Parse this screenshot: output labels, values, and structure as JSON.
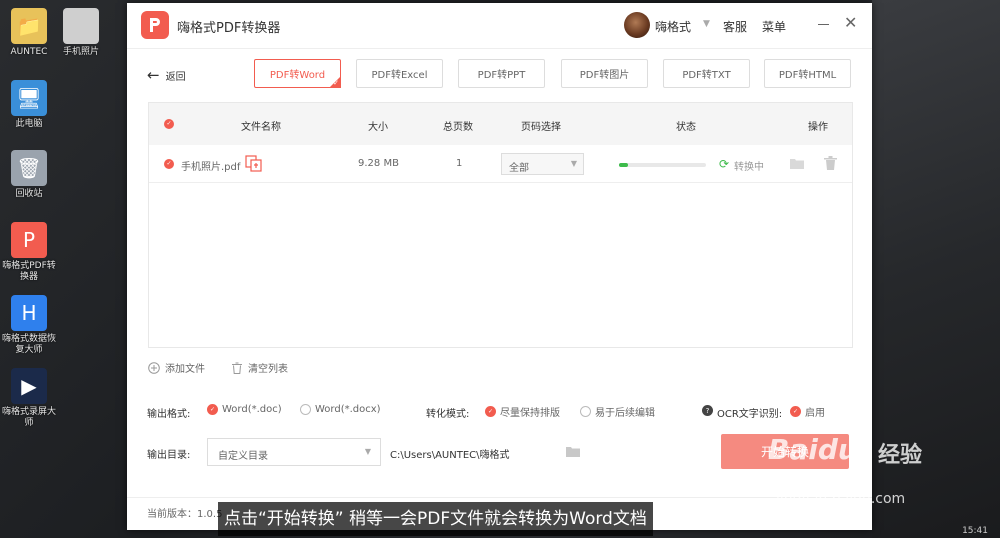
{
  "desktop": {
    "icons": [
      {
        "label": "AUNTEC"
      },
      {
        "label": "手机照片"
      },
      {
        "label": "此电脑"
      },
      {
        "label": "回收站"
      },
      {
        "label": "嗨格式PDF转换器"
      },
      {
        "label": "嗨格式数据恢复大师"
      },
      {
        "label": "嗨格式录屏大师"
      }
    ],
    "tray_text": "15:41"
  },
  "window": {
    "title": "嗨格式PDF转换器",
    "username": "嗨格式",
    "service": "客服",
    "menu": "菜单"
  },
  "nav": {
    "back_label": "返回",
    "tabs": [
      {
        "label": "PDF转Word",
        "active": true
      },
      {
        "label": "PDF转Excel"
      },
      {
        "label": "PDF转PPT"
      },
      {
        "label": "PDF转图片"
      },
      {
        "label": "PDF转TXT"
      },
      {
        "label": "PDF转HTML"
      }
    ]
  },
  "table": {
    "headers": {
      "name": "文件名称",
      "size": "大小",
      "pages": "总页数",
      "page_select": "页码选择",
      "status": "状态",
      "actions": "操作"
    },
    "rows": [
      {
        "name": "手机照片.pdf",
        "size": "9.28 MB",
        "pages": "1",
        "page_select": "全部",
        "progress": 0.1,
        "status": "转换中"
      }
    ]
  },
  "actions": {
    "add_file": "添加文件",
    "clear_list": "清空列表"
  },
  "options": {
    "format_label": "输出格式:",
    "format_doc": "Word(*.doc)",
    "format_docx": "Word(*.docx)",
    "mode_label": "转化模式:",
    "mode_keep": "尽量保持排版",
    "mode_edit": "易于后续编辑",
    "ocr_label": "OCR文字识别:",
    "ocr_enable": "启用",
    "dir_label": "输出目录:",
    "dir_select": "自定义目录",
    "out_path": "C:\\Users\\AUNTEC\\嗨格式",
    "start_button": "开始转换",
    "version": "当前版本：1.0.5"
  },
  "overlay": {
    "subtitle": "点击“开始转换” 稍等一会PDF文件就会转换为Word文档",
    "watermark_brand": "Baidu",
    "watermark_suffix": "经验",
    "watermark_url": "jingyan.baidu.com"
  },
  "colors": {
    "accent": "#f25c4f",
    "start_button": "#f58a80",
    "progress": "#3dbb4b"
  }
}
